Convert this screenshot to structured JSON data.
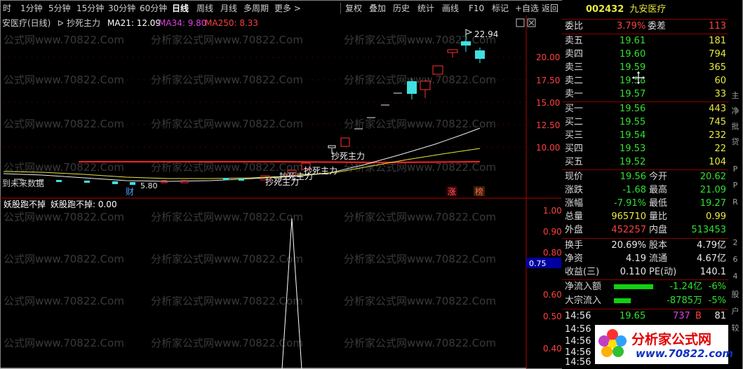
{
  "toolbar": {
    "items": [
      "时",
      "1分钟",
      "5分钟",
      "15分钟",
      "30分钟",
      "60分钟",
      "日线",
      "周线",
      "月线",
      "多周期",
      "更多 >"
    ],
    "active": "日线",
    "right_items": [
      "复权",
      "叠加",
      "历史",
      "统计",
      "画线",
      "F10",
      "标记",
      "+自选",
      "返回"
    ]
  },
  "chart": {
    "stock_name": "安医疗(日线)",
    "indicator_name": "抄死主力",
    "ma21": "MA21: 12.09",
    "ma34": "MA34: 9.80",
    "ma250": "MA250: 8.33",
    "price_labels": [
      "20.00",
      "17.50",
      "15.00",
      "12.50",
      "10.00"
    ],
    "high_label": "22.94",
    "low_label": "5.80",
    "future_label": "到未来数据",
    "signal_labels": [
      "抄死主力",
      "抄死主力",
      "抄死主力",
      "抄死主力"
    ],
    "badge_cai": "财",
    "badge_zhang": "涨",
    "badge_bang": "榜",
    "sub_title": "妖股跑不掉",
    "sub_value": "妖股跑不掉: 0.00",
    "sub_labels": [
      "1.00",
      "0.90",
      "0.80",
      "0.70",
      "0.60",
      "0.50",
      "0.40"
    ],
    "sub_current": "0.75",
    "watermark": "公式网www.70822.Com",
    "watermark_b": "分析家公式网www.70822.Com",
    "colors": {
      "ma21": "#ffffff",
      "ma34": "#e8e840",
      "ma250": "#ff2020",
      "up": "#ff3030",
      "down": "#40e0e0"
    }
  },
  "panel": {
    "code": "002432",
    "name": "九安医疗",
    "weibi_label": "委比",
    "weibi": "3.79%",
    "weicha_label": "委差",
    "weicha": "113",
    "asks": [
      {
        "label": "卖五",
        "price": "19.61",
        "vol": "181"
      },
      {
        "label": "卖四",
        "price": "19.60",
        "vol": "794"
      },
      {
        "label": "卖三",
        "price": "19.59",
        "vol": "365"
      },
      {
        "label": "卖二",
        "price": "19.58",
        "vol": "60"
      },
      {
        "label": "卖一",
        "price": "19.57",
        "vol": "33"
      }
    ],
    "bids": [
      {
        "label": "买一",
        "price": "19.56",
        "vol": "443"
      },
      {
        "label": "买二",
        "price": "19.55",
        "vol": "745"
      },
      {
        "label": "买三",
        "price": "19.54",
        "vol": "232"
      },
      {
        "label": "买四",
        "price": "19.53",
        "vol": "22"
      },
      {
        "label": "买五",
        "price": "19.52",
        "vol": "104"
      }
    ],
    "quote": [
      {
        "l1": "现价",
        "v1": "19.56",
        "c1": "green",
        "l2": "今开",
        "v2": "20.62",
        "c2": "green"
      },
      {
        "l1": "涨跌",
        "v1": "-1.68",
        "c1": "green",
        "l2": "最高",
        "v2": "21.09",
        "c2": "green"
      },
      {
        "l1": "涨幅",
        "v1": "-7.91%",
        "c1": "green",
        "l2": "最低",
        "v2": "19.27",
        "c2": "green"
      },
      {
        "l1": "总量",
        "v1": "965710",
        "c1": "yellow",
        "l2": "量比",
        "v2": "0.99",
        "c2": "yellow"
      },
      {
        "l1": "外盘",
        "v1": "452257",
        "c1": "red",
        "l2": "内盘",
        "v2": "513453",
        "c2": "green"
      }
    ],
    "fund": [
      {
        "l1": "换手",
        "v1": "20.69%",
        "l2": "股本",
        "v2": "4.79亿"
      },
      {
        "l1": "净资",
        "v1": "4.19",
        "l2": "流通",
        "v2": "4.67亿"
      },
      {
        "l1": "收益(三)",
        "v1": "0.110",
        "l2": "PE(动)",
        "v2": "140.1"
      }
    ],
    "flows": [
      {
        "label": "净流入额",
        "value": "-1.24亿",
        "pct": "-6%"
      },
      {
        "label": "大宗流入",
        "value": "-8785万",
        "pct": "-5%"
      }
    ],
    "ticks": [
      {
        "time": "14:56",
        "price": "19.65",
        "vol": "737",
        "flag": "B",
        "count": "81"
      },
      {
        "time": "14:56"
      },
      {
        "time": "14:56"
      },
      {
        "time": "14:56"
      },
      {
        "time": "14:56"
      }
    ],
    "logo_text": "分析家公式网",
    "logo_url": "www.70822.com"
  },
  "edge_chars": [
    "主",
    "净",
    "批",
    "贷",
    "P",
    "P",
    "R",
    "2",
    "6",
    "4",
    "股",
    "户",
    "较"
  ]
}
